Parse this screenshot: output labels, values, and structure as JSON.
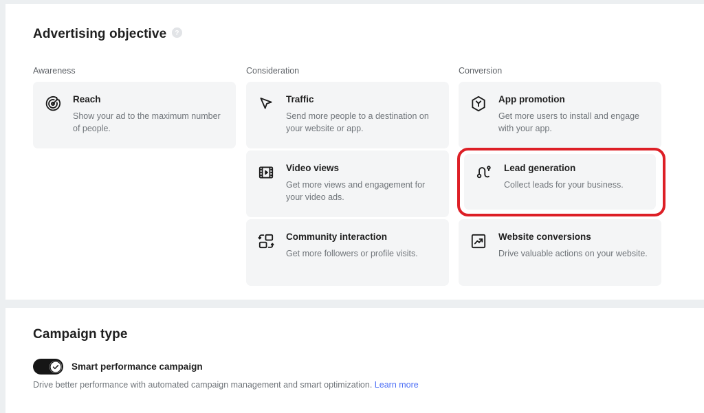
{
  "objective": {
    "title": "Advertising objective",
    "help_icon": "help-circle-icon",
    "columns": [
      {
        "key": "awareness",
        "label": "Awareness"
      },
      {
        "key": "consideration",
        "label": "Consideration"
      },
      {
        "key": "conversion",
        "label": "Conversion"
      }
    ],
    "cards": {
      "reach": {
        "icon": "target-arrow-icon",
        "title": "Reach",
        "desc": "Show your ad to the maximum number of people."
      },
      "traffic": {
        "icon": "cursor-pointer-icon",
        "title": "Traffic",
        "desc": "Send more people to a destination on your website or app."
      },
      "video_views": {
        "icon": "film-strip-play-icon",
        "title": "Video views",
        "desc": "Get more views and engagement for your video ads."
      },
      "community_interaction": {
        "icon": "community-exchange-icon",
        "title": "Community interaction",
        "desc": "Get more followers or profile visits."
      },
      "app_promotion": {
        "icon": "hexagon-app-icon",
        "title": "App promotion",
        "desc": "Get more users to install and engage with your app."
      },
      "lead_generation": {
        "icon": "lead-flow-icon",
        "title": "Lead generation",
        "desc": "Collect leads for your business.",
        "highlighted": true,
        "highlight_color": "#dd1f26"
      },
      "website_conversions": {
        "icon": "trend-up-box-icon",
        "title": "Website conversions",
        "desc": "Drive valuable actions on your website."
      }
    }
  },
  "campaign_type": {
    "title": "Campaign type",
    "toggle": {
      "label": "Smart performance campaign",
      "state": "on",
      "icon": "check-icon",
      "on_color": "#161616"
    },
    "description": "Drive better performance with automated campaign management and smart optimization.",
    "learn_more_label": "Learn more",
    "link_color": "#4c6ef5"
  }
}
